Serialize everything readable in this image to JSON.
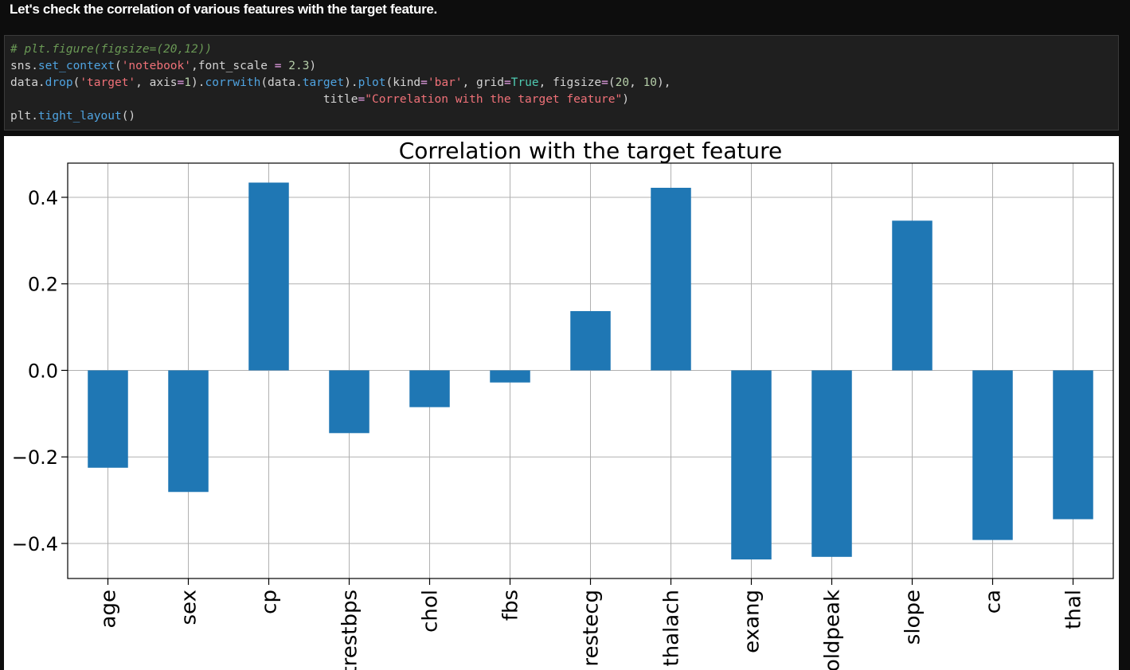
{
  "notebook": {
    "heading": "Let's check the correlation of various features with the target feature.",
    "code_lines": [
      [
        {
          "t": "# plt.figure(figsize=(20,12))",
          "c": "c-comment"
        }
      ],
      [
        {
          "t": "sns.",
          "c": ""
        },
        {
          "t": "set_context",
          "c": "c-fn"
        },
        {
          "t": "(",
          "c": ""
        },
        {
          "t": "'notebook'",
          "c": "c-str"
        },
        {
          "t": ",font_scale ",
          "c": ""
        },
        {
          "t": "=",
          "c": "c-op"
        },
        {
          "t": " 2.3",
          "c": "c-num"
        },
        {
          "t": ")",
          "c": ""
        }
      ],
      [
        {
          "t": "data.",
          "c": ""
        },
        {
          "t": "drop",
          "c": "c-fn"
        },
        {
          "t": "(",
          "c": ""
        },
        {
          "t": "'target'",
          "c": "c-str"
        },
        {
          "t": ", axis",
          "c": ""
        },
        {
          "t": "=",
          "c": "c-op"
        },
        {
          "t": "1",
          "c": "c-num"
        },
        {
          "t": ").",
          "c": ""
        },
        {
          "t": "corrwith",
          "c": "c-fn"
        },
        {
          "t": "(data.",
          "c": ""
        },
        {
          "t": "target",
          "c": "c-fn"
        },
        {
          "t": ").",
          "c": ""
        },
        {
          "t": "plot",
          "c": "c-fn"
        },
        {
          "t": "(kind",
          "c": ""
        },
        {
          "t": "=",
          "c": "c-op"
        },
        {
          "t": "'bar'",
          "c": "c-str"
        },
        {
          "t": ", grid",
          "c": ""
        },
        {
          "t": "=",
          "c": "c-op"
        },
        {
          "t": "True",
          "c": "c-kw"
        },
        {
          "t": ", figsize",
          "c": ""
        },
        {
          "t": "=",
          "c": "c-op"
        },
        {
          "t": "(",
          "c": ""
        },
        {
          "t": "20",
          "c": "c-num"
        },
        {
          "t": ", ",
          "c": ""
        },
        {
          "t": "10",
          "c": "c-num"
        },
        {
          "t": "),",
          "c": ""
        }
      ],
      [
        {
          "t": "                                             title",
          "c": ""
        },
        {
          "t": "=",
          "c": "c-op"
        },
        {
          "t": "\"Correlation with the target feature\"",
          "c": "c-str"
        },
        {
          "t": ")",
          "c": ""
        }
      ],
      [
        {
          "t": "plt.",
          "c": ""
        },
        {
          "t": "tight_layout",
          "c": "c-fn"
        },
        {
          "t": "()",
          "c": ""
        }
      ]
    ]
  },
  "chart_data": {
    "type": "bar",
    "title": "Correlation with the target feature",
    "xlabel": "",
    "ylabel": "",
    "categories": [
      "age",
      "sex",
      "cp",
      "trestbps",
      "chol",
      "fbs",
      "restecg",
      "thalach",
      "exang",
      "oldpeak",
      "slope",
      "ca",
      "thal"
    ],
    "values": [
      -0.225,
      -0.281,
      0.434,
      -0.145,
      -0.085,
      -0.028,
      0.137,
      0.422,
      -0.437,
      -0.431,
      0.346,
      -0.392,
      -0.344
    ],
    "yticks": [
      "0.4",
      "0.2",
      "0.0",
      "−0.2",
      "−0.4"
    ],
    "ylim": [
      -0.481,
      0.479
    ],
    "grid": true,
    "bar_color": "#1f77b4"
  }
}
